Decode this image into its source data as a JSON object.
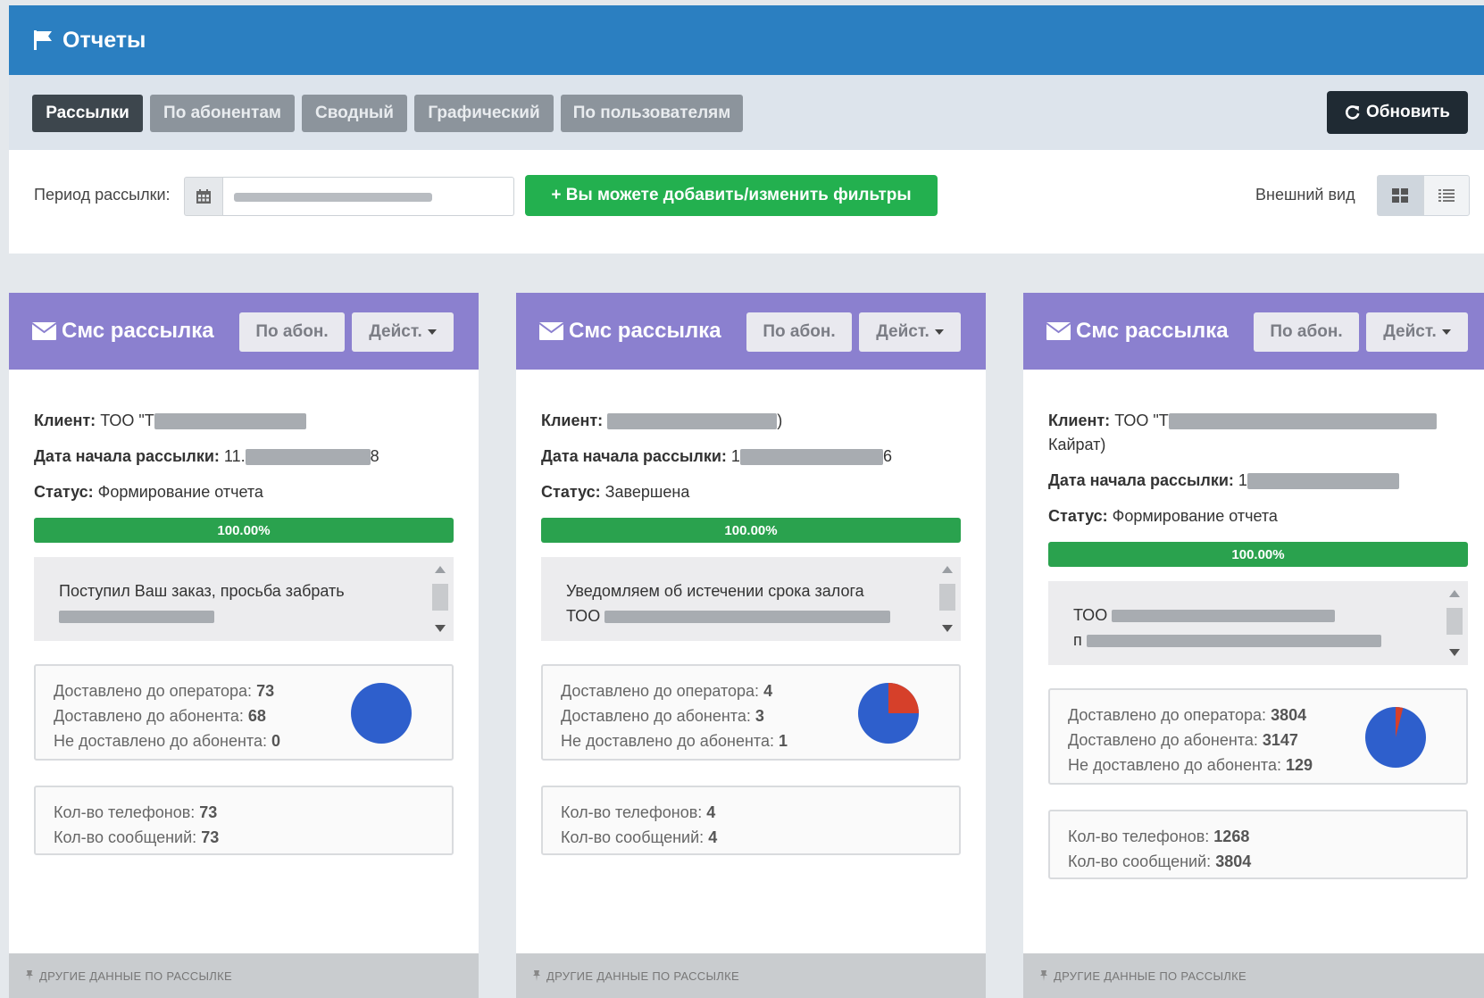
{
  "header": {
    "title": "Отчеты"
  },
  "tabs": [
    {
      "label": "Рассылки",
      "active": true
    },
    {
      "label": "По абонентам",
      "active": false
    },
    {
      "label": "Сводный",
      "active": false
    },
    {
      "label": "Графический",
      "active": false
    },
    {
      "label": "По пользователям",
      "active": false
    }
  ],
  "toolbar": {
    "refresh_label": "Обновить"
  },
  "filters": {
    "period_label": "Период рассылки:",
    "add_filters_label": "+ Вы можете добавить/изменить фильтры",
    "view_label": "Внешний вид"
  },
  "labels": {
    "client": "Клиент:",
    "start_date": "Дата начала рассылки:",
    "status": "Статус:",
    "delivered_operator": "Доставлено до оператора:",
    "delivered_subscriber": "Доставлено до абонента:",
    "not_delivered": "Не доставлено до абонента:",
    "phones_count": "Кол-во телефонов:",
    "messages_count": "Кол-во сообщений:",
    "footer": "ДРУГИЕ ДАННЫЕ ПО РАССЫЛКЕ",
    "by_abon_button": "По абон.",
    "actions_button": "Дейст."
  },
  "cards": [
    {
      "title": "Смс рассылка",
      "client": "ТОО \"Т",
      "client_extra": "",
      "start_date": "11.",
      "start_date_tail": "8",
      "status": "Формирование отчета",
      "progress_label": "100.00%",
      "progress": 1.0,
      "message": "Поступил Ваш заказ, просьба забрать",
      "delivered_operator": "73",
      "delivered_subscriber": "68",
      "not_delivered": "0",
      "phones": "73",
      "messages": "73",
      "pie_colors": [
        "#2e5fcc",
        "#d6402a"
      ]
    },
    {
      "title": "Смс рассылка",
      "client": "",
      "client_extra": ")",
      "start_date": "1",
      "start_date_tail": "6",
      "status": "Завершена",
      "progress_label": "100.00%",
      "progress": 1.0,
      "message": "Уведомляем об истечении срока залога",
      "message_line2": "ТОО",
      "delivered_operator": "4",
      "delivered_subscriber": "3",
      "not_delivered": "1",
      "phones": "4",
      "messages": "4",
      "pie_colors": [
        "#2e5fcc",
        "#d6402a"
      ]
    },
    {
      "title": "Смс рассылка",
      "client": "ТОО \"Т",
      "client_extra": "Кайрат)",
      "start_date": "1",
      "start_date_tail": "",
      "status": "Формирование отчета",
      "progress_label": "100.00%",
      "progress": 1.0,
      "message": "ТОО",
      "message_line2": "п",
      "delivered_operator": "3804",
      "delivered_subscriber": "3147",
      "not_delivered": "129",
      "phones": "1268",
      "messages": "3804",
      "pie_colors": [
        "#2e5fcc",
        "#d6402a"
      ]
    }
  ]
}
